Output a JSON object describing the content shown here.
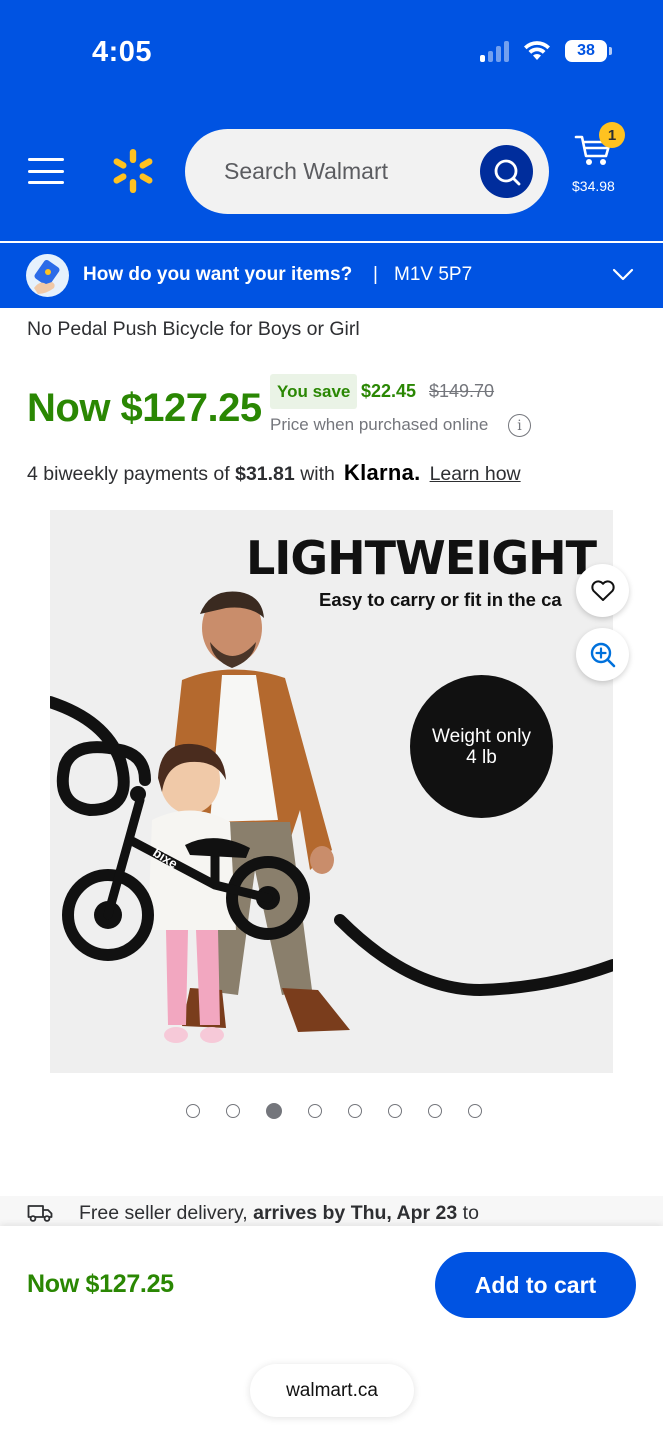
{
  "status_bar": {
    "time": "4:05",
    "battery": "38",
    "icons": [
      "cellular-signal-icon",
      "wifi-icon",
      "battery-icon"
    ]
  },
  "header": {
    "menu_icon": "hamburger-menu-icon",
    "logo_icon": "walmart-spark-icon",
    "search": {
      "placeholder": "Search Walmart",
      "icon": "search-icon"
    },
    "cart": {
      "icon": "cart-icon",
      "count": "1",
      "total": "$34.98"
    }
  },
  "fulfillment": {
    "question": "How do you want your items?",
    "separator": "|",
    "postal_code": "M1V 5P7",
    "icon": "chevron-down-icon"
  },
  "product": {
    "title": "No Pedal Push Bicycle for Boys or Girl",
    "price_now": "Now $127.25",
    "you_save_label": "You save",
    "save_amount": "$22.45",
    "was_price": "$149.70",
    "price_note": "Price when purchased online",
    "klarna": {
      "prefix": "4 biweekly payments of",
      "amount": "$31.81",
      "with": "with",
      "logo": "Klarna.",
      "link": "Learn how"
    }
  },
  "gallery": {
    "headline": "LIGHTWEIGHT",
    "subtitle": "Easy to carry or fit in the ca",
    "badge_line1": "Weight only",
    "badge_line2": "4 lb",
    "bike_brand": "bixe",
    "dot_count": 8,
    "active_index": 2
  },
  "delivery": {
    "text_prefix": "Free seller delivery,",
    "text_bold": "arrives by Thu, Apr 23",
    "text_suffix": "to"
  },
  "bottom_bar": {
    "price": "Now $127.25",
    "add_to_cart": "Add to cart"
  },
  "browser": {
    "url": "walmart.ca"
  },
  "colors": {
    "brand_blue": "#0053e2",
    "dark_blue": "#002d9c",
    "spark_yellow": "#ffc220",
    "price_green": "#2a8703",
    "text_gray": "#74767c"
  }
}
